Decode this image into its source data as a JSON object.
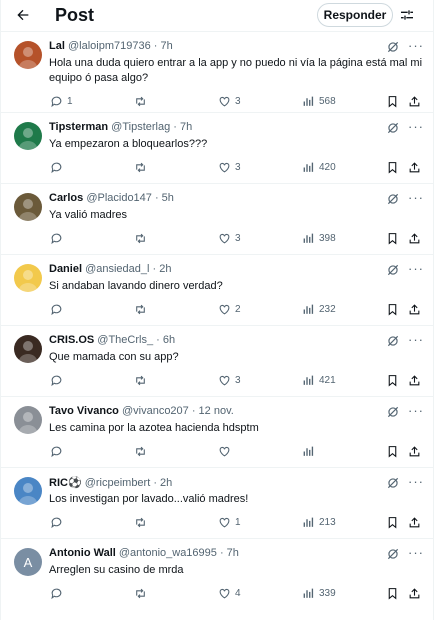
{
  "header": {
    "title": "Post",
    "reply_button": "Responder"
  },
  "tweets": [
    {
      "name": "Lal",
      "handle": "@laloipm719736 · 7h",
      "text": "Hola una duda quiero entrar a la app y no puedo ni vía la página está mal mi equipo ó pasa algo?",
      "replies": "1",
      "retweets": "",
      "likes": "3",
      "views": "568",
      "avatar_color": "#b5522a"
    },
    {
      "name": "Tipsterman",
      "handle": "@Tipsterlag · 7h",
      "text": "Ya empezaron a bloquearlos???",
      "replies": "",
      "retweets": "",
      "likes": "3",
      "views": "420",
      "avatar_color": "#1f7a4a"
    },
    {
      "name": "Carlos",
      "handle": "@Placido147 · 5h",
      "text": "Ya valió madres",
      "replies": "",
      "retweets": "",
      "likes": "3",
      "views": "398",
      "avatar_color": "#6b5a3a"
    },
    {
      "name": "Daniel",
      "handle": "@ansiedad_l · 2h",
      "text": "Si andaban lavando dinero verdad?",
      "replies": "",
      "retweets": "",
      "likes": "2",
      "views": "232",
      "avatar_color": "#f2c94c"
    },
    {
      "name": "CRIS.OS",
      "handle": "@TheCrls_ · 6h",
      "text": "Que mamada con su app?",
      "replies": "",
      "retweets": "",
      "likes": "3",
      "views": "421",
      "avatar_color": "#3a2a22"
    },
    {
      "name": "Tavo Vivanco",
      "handle": "@vivanco207 · 12 nov.",
      "text": "Les camina por la azotea hacienda hdsptm",
      "replies": "",
      "retweets": "",
      "likes": "",
      "views": "",
      "avatar_color": "#8a8f96"
    },
    {
      "name": "RIC⚽",
      "handle": "@ricpeimbert · 2h",
      "text": "Los investigan por lavado...valió madres!",
      "replies": "",
      "retweets": "",
      "likes": "1",
      "views": "213",
      "avatar_color": "#4a86c5"
    },
    {
      "name": "Antonio Wall",
      "handle": "@antonio_wa16995 · 7h",
      "text": "Arreglen su casino de mrda",
      "replies": "",
      "retweets": "",
      "likes": "4",
      "views": "339",
      "avatar_color": "#7a8ea3",
      "avatar_letter": "A"
    }
  ]
}
